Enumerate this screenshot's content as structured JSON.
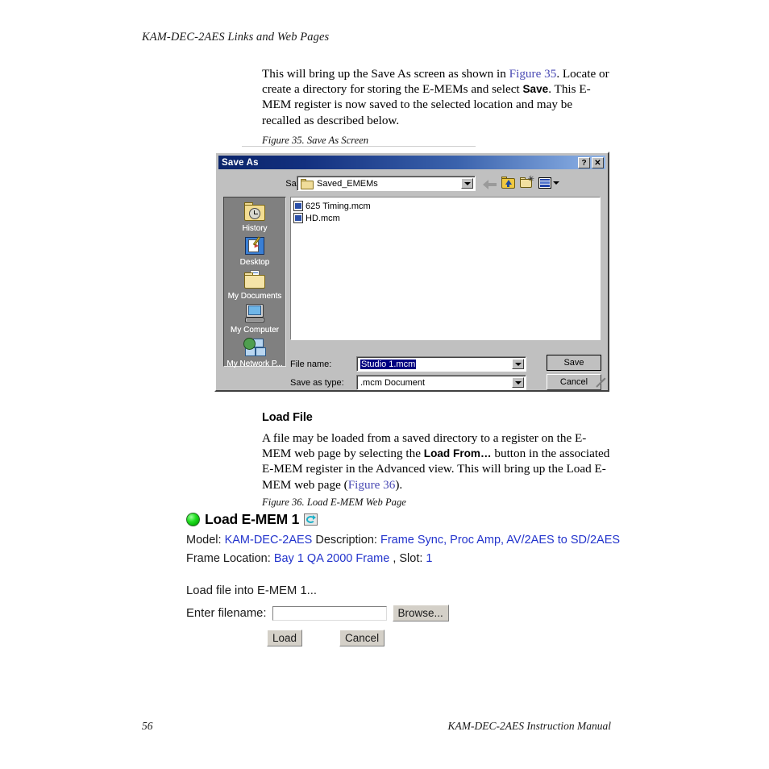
{
  "page": {
    "running_head": "KAM-DEC-2AES Links and Web Pages",
    "footer_page_number": "56",
    "footer_title": "KAM-DEC-2AES Instruction Manual"
  },
  "body": {
    "intro_html": "This will bring up the Save As screen as shown in <span class=\"xref\">Figure 35</span>. Locate or create a directory for storing the E-MEMs and select <b>Save</b>. This E-MEM register is now saved to the selected location and may be recalled as described below.",
    "figure_35_caption": "Figure 35.  Save As Screen",
    "section_heading": "Load File",
    "load_para_html": "A file may be loaded from a saved directory to a register on the E-MEM web page by selecting the <b>Load From…</b> button in the associated E-MEM register in the Advanced view. This will bring up the Load E-MEM web page (<span class=\"xref\">Figure 36</span>).",
    "figure_36_caption": "Figure 36.  Load E-MEM Web Page"
  },
  "save_as_dialog": {
    "title": "Save As",
    "help_button": "?",
    "close_button": "✕",
    "save_in_label": "Save in:",
    "save_in_value": "Saved_EMEMs",
    "toolbar": [
      {
        "name": "back",
        "tooltip": "Back"
      },
      {
        "name": "up-one-level",
        "tooltip": "Up One Level"
      },
      {
        "name": "create-new-folder",
        "tooltip": "Create New Folder"
      },
      {
        "name": "views",
        "tooltip": "Views"
      }
    ],
    "places": [
      {
        "label": "History",
        "icon": "history-icon"
      },
      {
        "label": "Desktop",
        "icon": "desktop-icon"
      },
      {
        "label": "My Documents",
        "icon": "my-documents-icon"
      },
      {
        "label": "My Computer",
        "icon": "my-computer-icon"
      },
      {
        "label": "My Network P...",
        "icon": "my-network-places-icon"
      }
    ],
    "files": [
      {
        "name": "625 Timing.mcm"
      },
      {
        "name": "HD.mcm"
      }
    ],
    "file_name_label": "File name:",
    "file_name_value": "Studio 1.mcm",
    "save_as_type_label": "Save as type:",
    "save_as_type_value": ".mcm Document",
    "save_button": "Save",
    "cancel_button": "Cancel"
  },
  "load_emem_page": {
    "title": "Load E-MEM 1",
    "model_label": "Model:",
    "model_value": "KAM-DEC-2AES",
    "description_label": "Description:",
    "description_value": "Frame Sync, Proc Amp, AV/2AES to SD/2AES",
    "frame_location_label": "Frame Location:",
    "frame_location_value": "Bay 1 QA 2000 Frame",
    "slot_label": ", Slot:",
    "slot_value": "1",
    "instruction": "Load file into E-MEM 1...",
    "filename_label": "Enter filename:",
    "filename_value": "",
    "browse_button": "Browse...",
    "load_button": "Load",
    "cancel_button": "Cancel"
  },
  "colors": {
    "xref_link": "#4a4ab4",
    "web_link": "#2233cc",
    "titlebar_start": "#0a246a",
    "titlebar_end": "#8fb4e8",
    "dialog_face": "#c0c0c0",
    "selection": "#000080",
    "led_green": "#22e022"
  }
}
